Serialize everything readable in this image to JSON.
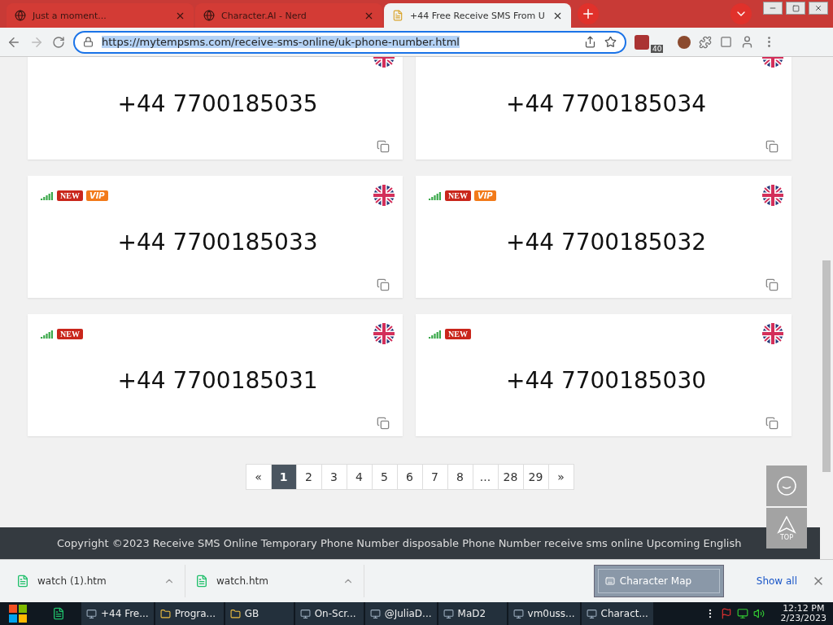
{
  "browser": {
    "tabs": [
      {
        "title": "Just a moment...",
        "selected": false
      },
      {
        "title": "Character.AI - Nerd",
        "selected": false
      },
      {
        "title": "+44 Free Receive SMS From U",
        "selected": true
      }
    ],
    "url": "https://mytempsms.com/receive-sms-online/uk-phone-number.html",
    "extension_badge": "40"
  },
  "numbers": [
    {
      "number": "+44 7700185035"
    },
    {
      "number": "+44 7700185034"
    },
    {
      "number": "+44 7700185033",
      "badges": [
        {
          "kind": "new",
          "label": "NEW"
        },
        {
          "kind": "vip",
          "label": "VIP"
        }
      ]
    },
    {
      "number": "+44 7700185032",
      "badges": [
        {
          "kind": "new",
          "label": "NEW"
        },
        {
          "kind": "vip",
          "label": "VIP"
        }
      ]
    },
    {
      "number": "+44 7700185031",
      "badges": [
        {
          "kind": "new",
          "label": "NEW"
        }
      ]
    },
    {
      "number": "+44 7700185030",
      "badges": [
        {
          "kind": "new",
          "label": "NEW"
        }
      ]
    }
  ],
  "pagination": [
    {
      "label": "«",
      "selected": false
    },
    {
      "label": "1",
      "selected": true
    },
    {
      "label": "2",
      "selected": false
    },
    {
      "label": "3",
      "selected": false
    },
    {
      "label": "4",
      "selected": false
    },
    {
      "label": "5",
      "selected": false
    },
    {
      "label": "6",
      "selected": false
    },
    {
      "label": "7",
      "selected": false
    },
    {
      "label": "8",
      "selected": false
    },
    {
      "label": "...",
      "selected": false
    },
    {
      "label": "28",
      "selected": false
    },
    {
      "label": "29",
      "selected": false
    },
    {
      "label": "»",
      "selected": false
    }
  ],
  "float_buttons": {
    "top_label": "TOP"
  },
  "footer": {
    "text": "Copyright ©2023 Receive SMS Online Temporary Phone Number disposable Phone Number receive sms online Upcoming  English"
  },
  "downloads": {
    "items": [
      "watch (1).htm",
      "watch.htm"
    ],
    "popup": "Character Map",
    "show_all": "Show all"
  },
  "taskbar": {
    "apps": [
      "+44 Fre...",
      "Progra...",
      "GB",
      "On-Scr...",
      "@JuliaD...",
      "MaD2",
      "vm0uss...",
      "Charact..."
    ],
    "time": "12:12 PM",
    "date": "2/23/2023"
  }
}
